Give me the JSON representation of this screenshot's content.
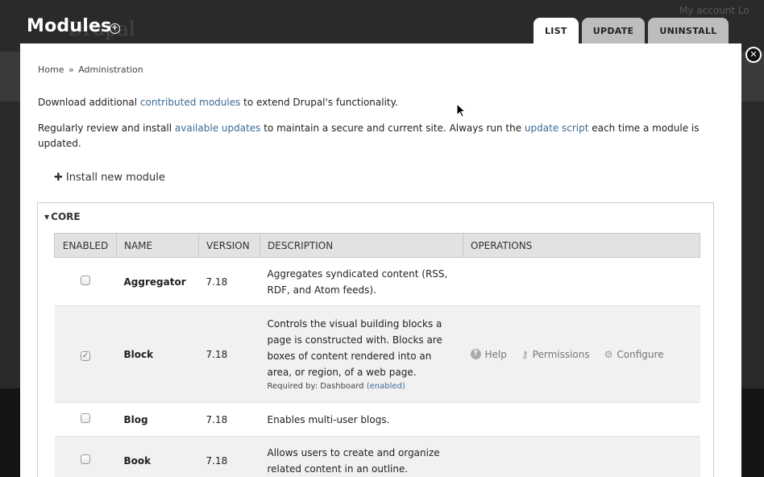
{
  "background": {
    "my_account": "My account   Lo",
    "site_name": "Drupal"
  },
  "overlay": {
    "title": "Modules",
    "add_shortcut_glyph": "+",
    "close_glyph": "✕",
    "tabs": [
      {
        "label": "LIST",
        "active": true
      },
      {
        "label": "UPDATE",
        "active": false
      },
      {
        "label": "UNINSTALL",
        "active": false
      }
    ]
  },
  "breadcrumb": {
    "home": "Home",
    "separator": "»",
    "admin": "Administration"
  },
  "intro": {
    "line1_pre": "Download additional ",
    "line1_link": "contributed modules",
    "line1_post": " to extend Drupal's functionality.",
    "line2_pre": "Regularly review and install ",
    "line2_link1": "available updates",
    "line2_mid": " to maintain a secure and current site. Always run the ",
    "line2_link2": "update script",
    "line2_post": " each time a module is updated."
  },
  "install_link": "Install new module",
  "fieldset": {
    "legend": "CORE"
  },
  "table": {
    "headers": [
      "ENABLED",
      "NAME",
      "VERSION",
      "DESCRIPTION",
      "OPERATIONS"
    ],
    "rows": [
      {
        "enabled": false,
        "name": "Aggregator",
        "version": "7.18",
        "description": "Aggregates syndicated content (RSS, RDF, and Atom feeds).",
        "required_by": "",
        "ops": []
      },
      {
        "enabled": true,
        "name": "Block",
        "version": "7.18",
        "description": "Controls the visual building blocks a page is constructed with. Blocks are boxes of content rendered into an area, or region, of a web page.",
        "required_pre": "Required by: Dashboard ",
        "required_link": "(enabled)",
        "ops": [
          "Help",
          "Permissions",
          "Configure"
        ]
      },
      {
        "enabled": false,
        "name": "Blog",
        "version": "7.18",
        "description": "Enables multi-user blogs.",
        "required_by": "",
        "ops": []
      },
      {
        "enabled": false,
        "name": "Book",
        "version": "7.18",
        "description": "Allows users to create and organize related content in an outline.",
        "required_by": "",
        "ops": []
      }
    ]
  },
  "icons": {
    "collapse": "triangle-down-icon",
    "help": "help-icon",
    "permissions": "key-icon",
    "configure": "gear-icon",
    "checked": "checkmark-icon"
  },
  "colors": {
    "link": "#3b6a94",
    "tab_active": "#ffffff",
    "tab_inactive": "#bdbdbd",
    "header_bg": "#e2e2e2"
  }
}
